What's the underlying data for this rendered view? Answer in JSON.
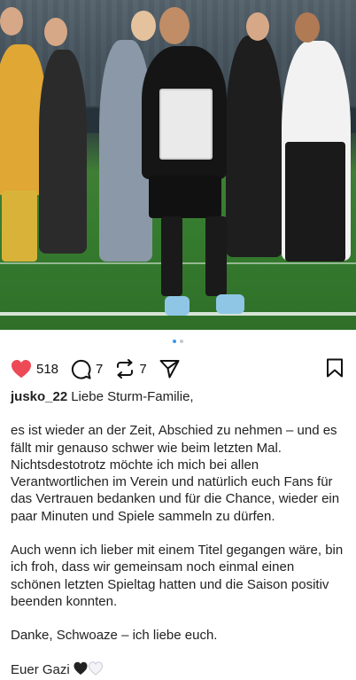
{
  "post": {
    "media": {
      "alt": "",
      "carousel_dots": 2,
      "carousel_active_index": 0
    },
    "actions": {
      "likes": "518",
      "comments": "7",
      "reposts": "7",
      "like_icon": "heart-filled-icon",
      "comment_icon": "comment-bubble-icon",
      "repost_icon": "repost-arrows-icon",
      "share_icon": "paper-plane-icon",
      "save_icon": "bookmark-icon",
      "like_color": "#ed4956"
    },
    "caption": {
      "username": "jusko_22",
      "greeting": "Liebe Sturm-Familie,",
      "paragraph1": "es ist wieder an der Zeit, Abschied zu nehmen – und es fällt mir genauso schwer wie beim letzten Mal. Nichtsdestotrotz möchte ich mich bei allen Verantwortlichen im Verein und natürlich euch Fans für das Vertrauen bedanken und für die Chance, wieder ein paar Minuten und Spiele sammeln zu dürfen.",
      "paragraph2": "Auch wenn ich lieber mit einem Titel gegangen wäre, bin ich froh, dass wir gemeinsam noch einmal einen schönen letzten Spieltag hatten und die Saison positiv beenden konnten.",
      "paragraph3": "Danke, Schwoaze – ich liebe euch.",
      "signoff": "Euer Gazi",
      "signoff_emoji": "black-heart-white-heart"
    }
  }
}
